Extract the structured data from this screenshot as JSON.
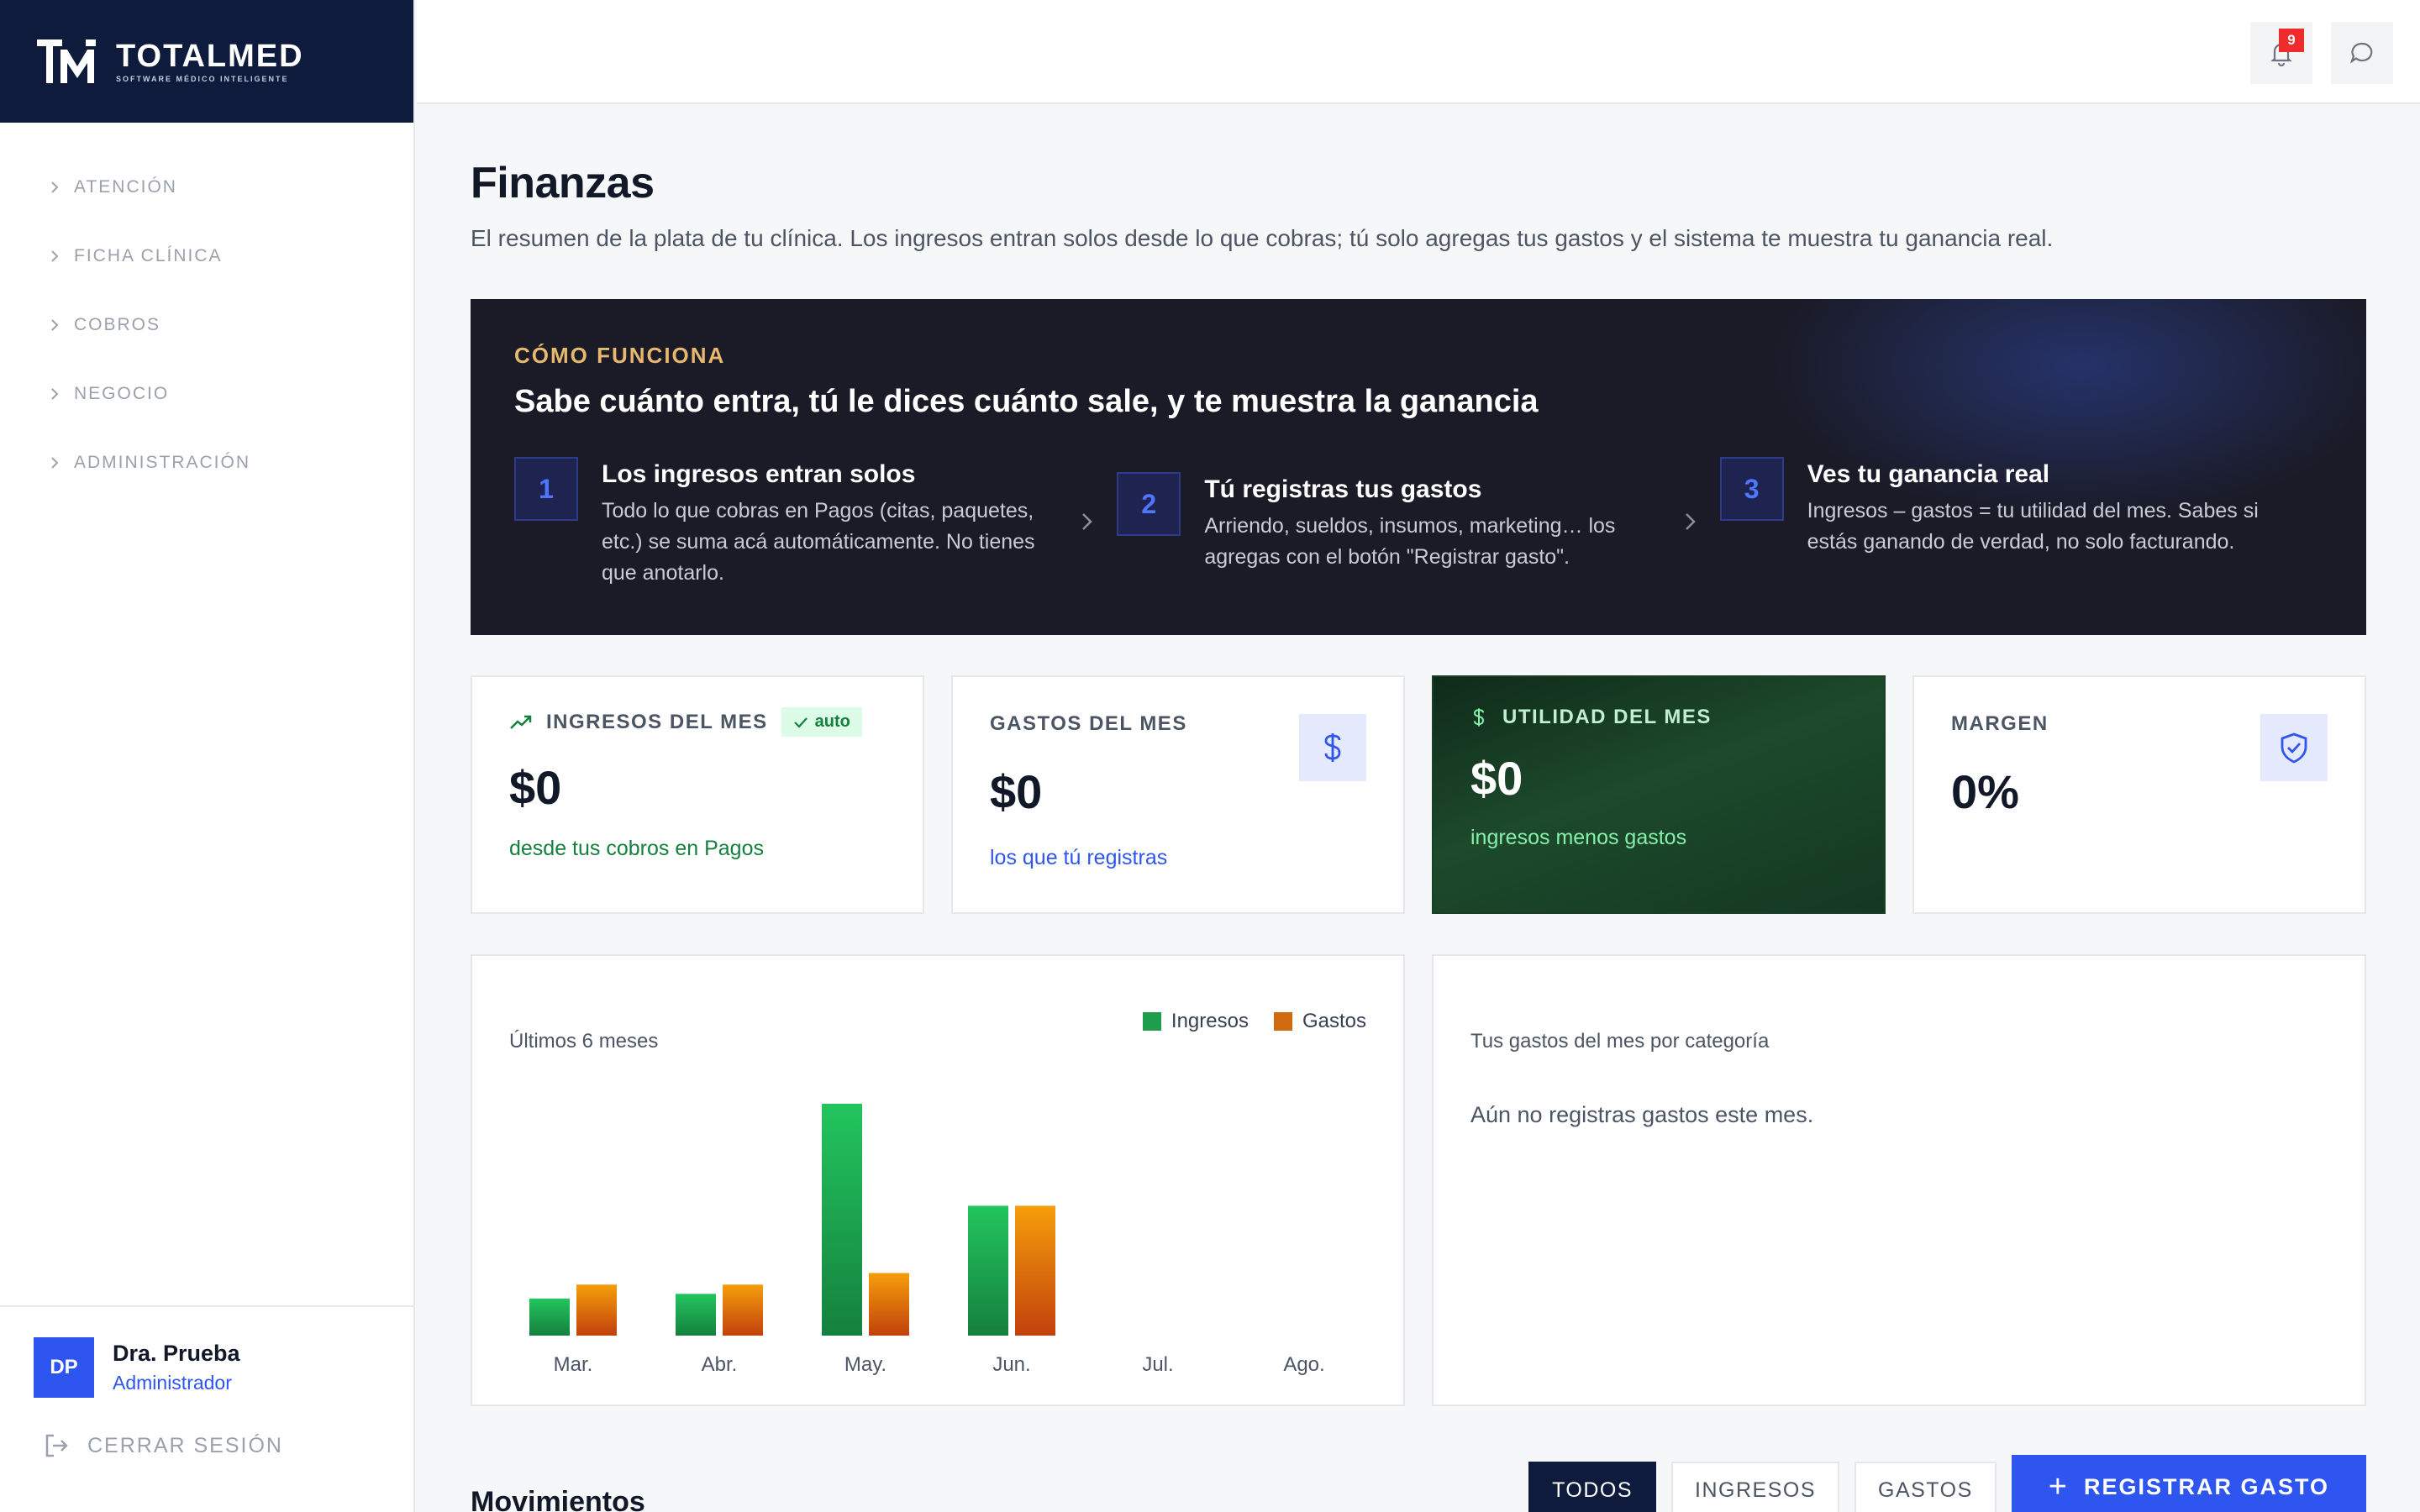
{
  "brand": {
    "name": "TOTALMED",
    "tagline": "SOFTWARE MÉDICO INTELIGENTE",
    "mark": "TM"
  },
  "nav": [
    {
      "label": "ATENCIÓN"
    },
    {
      "label": "FICHA CLÍNICA"
    },
    {
      "label": "COBROS"
    },
    {
      "label": "NEGOCIO"
    },
    {
      "label": "ADMINISTRACIÓN"
    }
  ],
  "user": {
    "initials": "DP",
    "name": "Dra. Prueba",
    "role": "Administrador",
    "logout_label": "CERRAR SESIÓN"
  },
  "topbar": {
    "notifications_count": "9"
  },
  "page": {
    "title": "Finanzas",
    "description": "El resumen de la plata de tu clínica. Los ingresos entran solos desde lo que cobras; tú solo agregas tus gastos y el sistema te muestra tu ganancia real."
  },
  "how_it_works": {
    "eyebrow": "CÓMO FUNCIONA",
    "title": "Sabe cuánto entra, tú le dices cuánto sale, y te muestra la ganancia",
    "steps": [
      {
        "num": "1",
        "title": "Los ingresos entran solos",
        "text": "Todo lo que cobras en Pagos (citas, paquetes, etc.) se suma acá automáticamente. No tienes que anotarlo."
      },
      {
        "num": "2",
        "title": "Tú registras tus gastos",
        "text": "Arriendo, sueldos, insumos, marketing… los agregas con el botón \"Registrar gasto\"."
      },
      {
        "num": "3",
        "title": "Ves tu ganancia real",
        "text": "Ingresos – gastos = tu utilidad del mes. Sabes si estás ganando de verdad, no solo facturando."
      }
    ]
  },
  "cards": {
    "ingresos": {
      "label": "INGRESOS DEL MES",
      "badge": "auto",
      "value": "$0",
      "sub": "desde tus cobros en Pagos"
    },
    "gastos": {
      "label": "GASTOS DEL MES",
      "value": "$0",
      "sub": "los que tú registras"
    },
    "utilidad": {
      "label": "UTILIDAD DEL MES",
      "value": "$0",
      "sub": "ingresos menos gastos"
    },
    "margen": {
      "label": "MARGEN",
      "value": "0%"
    }
  },
  "chart_panel": {
    "title": "Últimos 6 meses"
  },
  "chart_data": {
    "type": "bar",
    "categories": [
      "Mar.",
      "Abr.",
      "May.",
      "Jun.",
      "Jul.",
      "Ago."
    ],
    "series": [
      {
        "name": "Ingresos",
        "values": [
          16,
          18,
          100,
          56,
          0,
          0
        ]
      },
      {
        "name": "Gastos",
        "values": [
          22,
          22,
          27,
          56,
          0,
          0
        ]
      }
    ],
    "colors": {
      "Ingresos": "#1f9d4d",
      "Gastos": "#e07c14"
    },
    "ylim": [
      0,
      100
    ],
    "legend": "top-right",
    "grid": false
  },
  "categories_panel": {
    "title": "Tus gastos del mes por categoría",
    "empty": "Aún no registras gastos este mes."
  },
  "movimientos": {
    "title": "Movimientos",
    "filters": [
      {
        "label": "TODOS"
      },
      {
        "label": "INGRESOS"
      },
      {
        "label": "GASTOS"
      }
    ],
    "register_label": "REGISTRAR GASTO"
  },
  "colors": {
    "brand_dark": "#0f1b3d",
    "accent_blue": "#2f55f0",
    "income_green": "#1f9d4d",
    "expense_orange": "#e07c14",
    "badge_red": "#ef2b2b"
  }
}
